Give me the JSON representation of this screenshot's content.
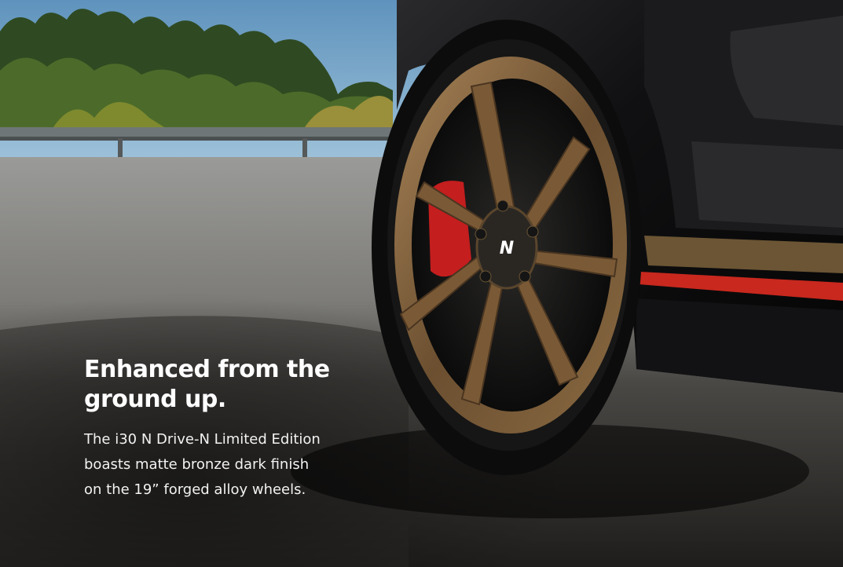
{
  "headline": {
    "line1": "Enhanced from the",
    "line2": "ground up."
  },
  "body": {
    "line1": "The i30 N Drive-N Limited Edition",
    "line2": "boasts matte bronze dark finish",
    "line3": "on the 19” forged alloy wheels."
  },
  "wheel_badge": {
    "logo": "N"
  },
  "colors": {
    "bronze": "#7a5a36",
    "body_black": "#141414",
    "accent_red": "#c8281e",
    "sky": "#6f9fc4"
  }
}
